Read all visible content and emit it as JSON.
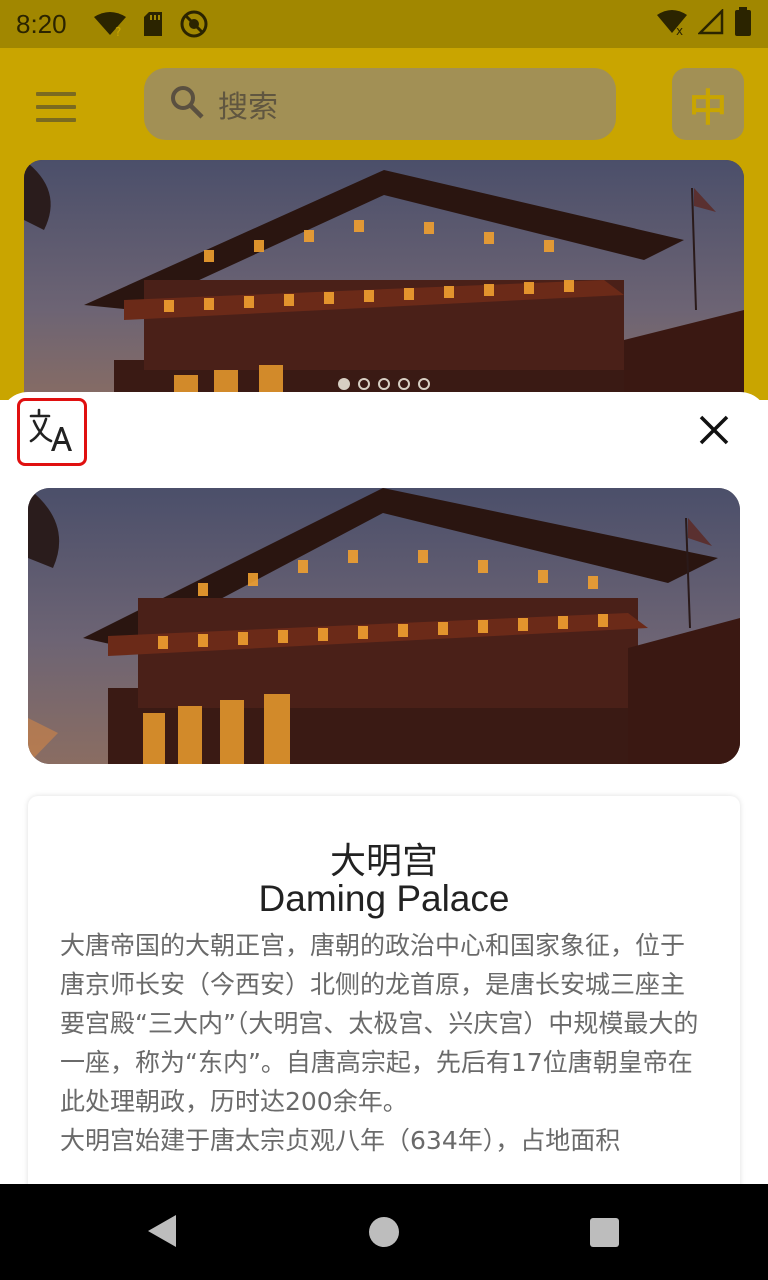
{
  "status_bar": {
    "time": "8:20"
  },
  "app_bar": {
    "search_placeholder": "搜索",
    "language_label": "中",
    "carousel_dots": 5,
    "carousel_active_index": 0
  },
  "sheet": {
    "title_cn": "大明宫",
    "title_en": "Daming Palace",
    "paragraphs": [
      "大唐帝国的大朝正宫，唐朝的政治中心和国家象征，位于唐京师长安（今西安）北侧的龙首原，是唐长安城三座主要宫殿“三大内”（大明宫、太极宫、兴庆宫）中规模最大的一座，称为“东内”。自唐高宗起，先后有17位唐朝皇帝在此处理朝政，历时达200余年。",
      "大明宫始建于唐太宗贞观八年（634年），占地面积"
    ]
  },
  "icons": {
    "menu": "menu-icon",
    "search": "search-icon",
    "translate": "translate-icon",
    "close": "close-icon"
  },
  "colors": {
    "app_bar": "#c9a500",
    "status_bar": "#a18700",
    "highlight_border": "#e01010"
  }
}
